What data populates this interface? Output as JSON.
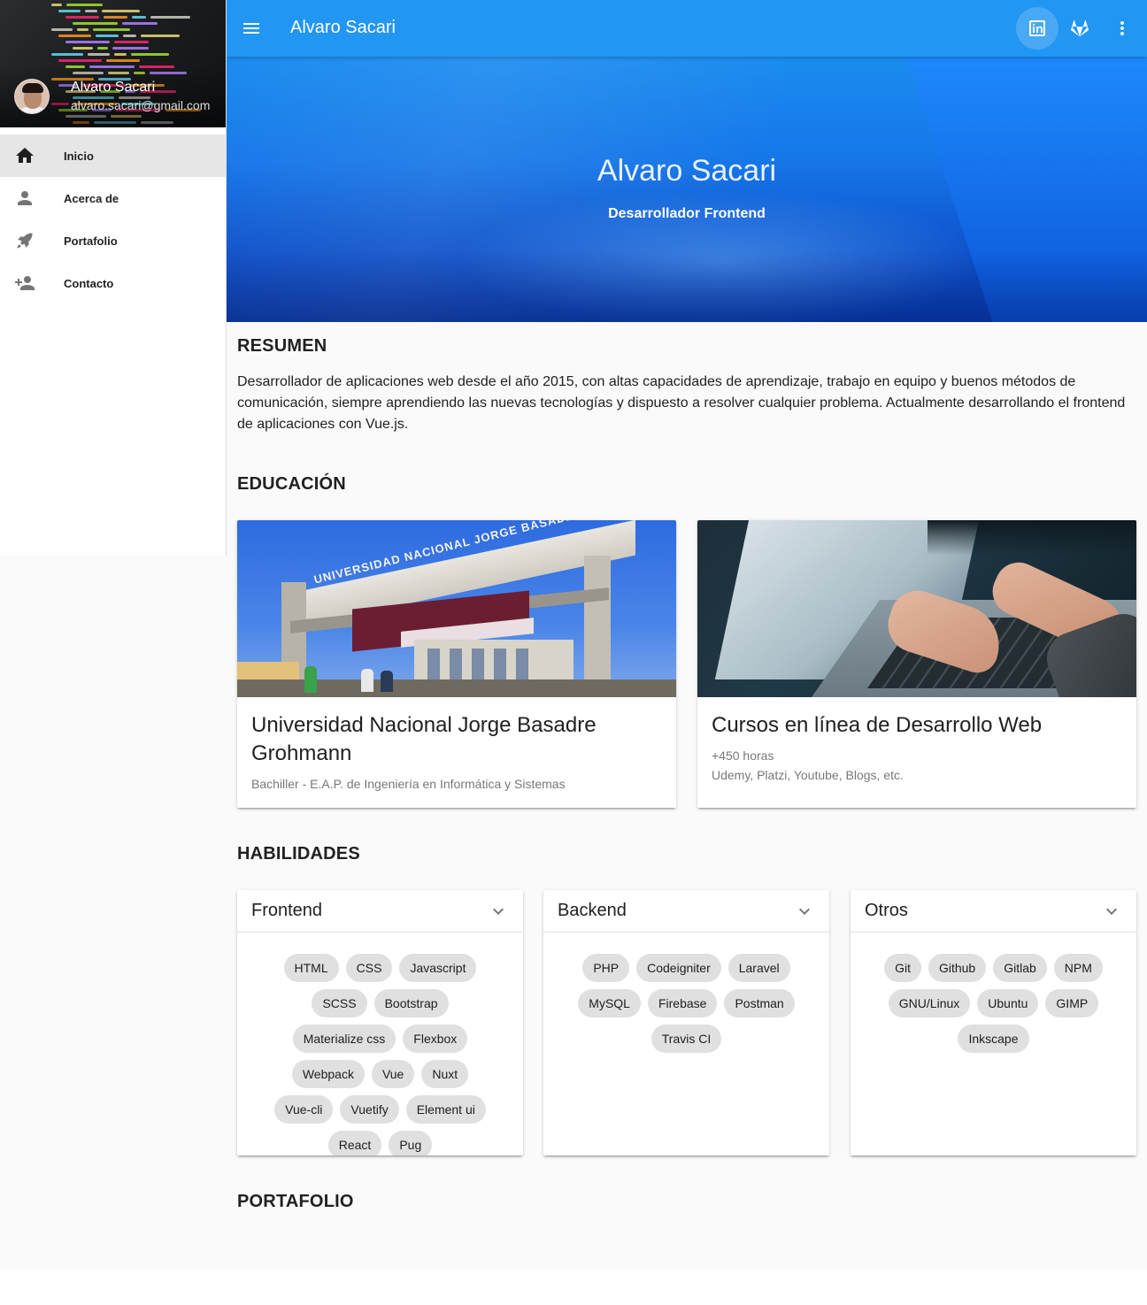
{
  "drawer": {
    "user_name": "Alvaro Sacari",
    "user_email": "alvaro.sacari@gmail.com",
    "items": [
      {
        "label": "Inicio",
        "icon": "home-icon",
        "active": true
      },
      {
        "label": "Acerca de",
        "icon": "person-icon",
        "active": false
      },
      {
        "label": "Portafolio",
        "icon": "rocket-icon",
        "active": false
      },
      {
        "label": "Contacto",
        "icon": "person-add-icon",
        "active": false
      }
    ]
  },
  "toolbar": {
    "title": "Alvaro Sacari",
    "icons": [
      "menu-icon",
      "linkedin-icon",
      "gitlab-icon",
      "more-vert-icon"
    ],
    "color": "#2196f3"
  },
  "hero": {
    "title": "Alvaro Sacari",
    "subtitle": "Desarrollador Frontend"
  },
  "summary": {
    "heading": "RESUMEN",
    "text": "Desarrollador de aplicaciones web desde el año 2015, con altas capacidades de aprendizaje, trabajo en equipo y buenos métodos de comunicación, siempre aprendiendo las nuevas tecnologías y dispuesto a resolver cualquier problema. Actualmente desarrollando el frontend de aplicaciones con Vue.js."
  },
  "education": {
    "heading": "EDUCACIÓN",
    "cards": [
      {
        "title": "Universidad Nacional Jorge Basadre Grohmann",
        "lines": [
          "Bachiller - E.A.P. de Ingeniería en Informática y Sistemas"
        ],
        "image_text": "UNIVERSIDAD NACIONAL JORGE BASADRE GROHMANN"
      },
      {
        "title": "Cursos en línea de Desarrollo Web",
        "lines": [
          "+450 horas",
          "Udemy, Platzi, Youtube, Blogs, etc."
        ]
      }
    ]
  },
  "skills": {
    "heading": "HABILIDADES",
    "groups": [
      {
        "title": "Frontend",
        "chips": [
          "HTML",
          "CSS",
          "Javascript",
          "SCSS",
          "Bootstrap",
          "Materialize css",
          "Flexbox",
          "Webpack",
          "Vue",
          "Nuxt",
          "Vue-cli",
          "Vuetify",
          "Element ui",
          "React",
          "Pug"
        ]
      },
      {
        "title": "Backend",
        "chips": [
          "PHP",
          "Codeigniter",
          "Laravel",
          "MySQL",
          "Firebase",
          "Postman",
          "Travis CI"
        ]
      },
      {
        "title": "Otros",
        "chips": [
          "Git",
          "Github",
          "Gitlab",
          "NPM",
          "GNU/Linux",
          "Ubuntu",
          "GIMP",
          "Inkscape"
        ]
      }
    ]
  },
  "portfolio": {
    "heading": "PORTAFOLIO"
  }
}
